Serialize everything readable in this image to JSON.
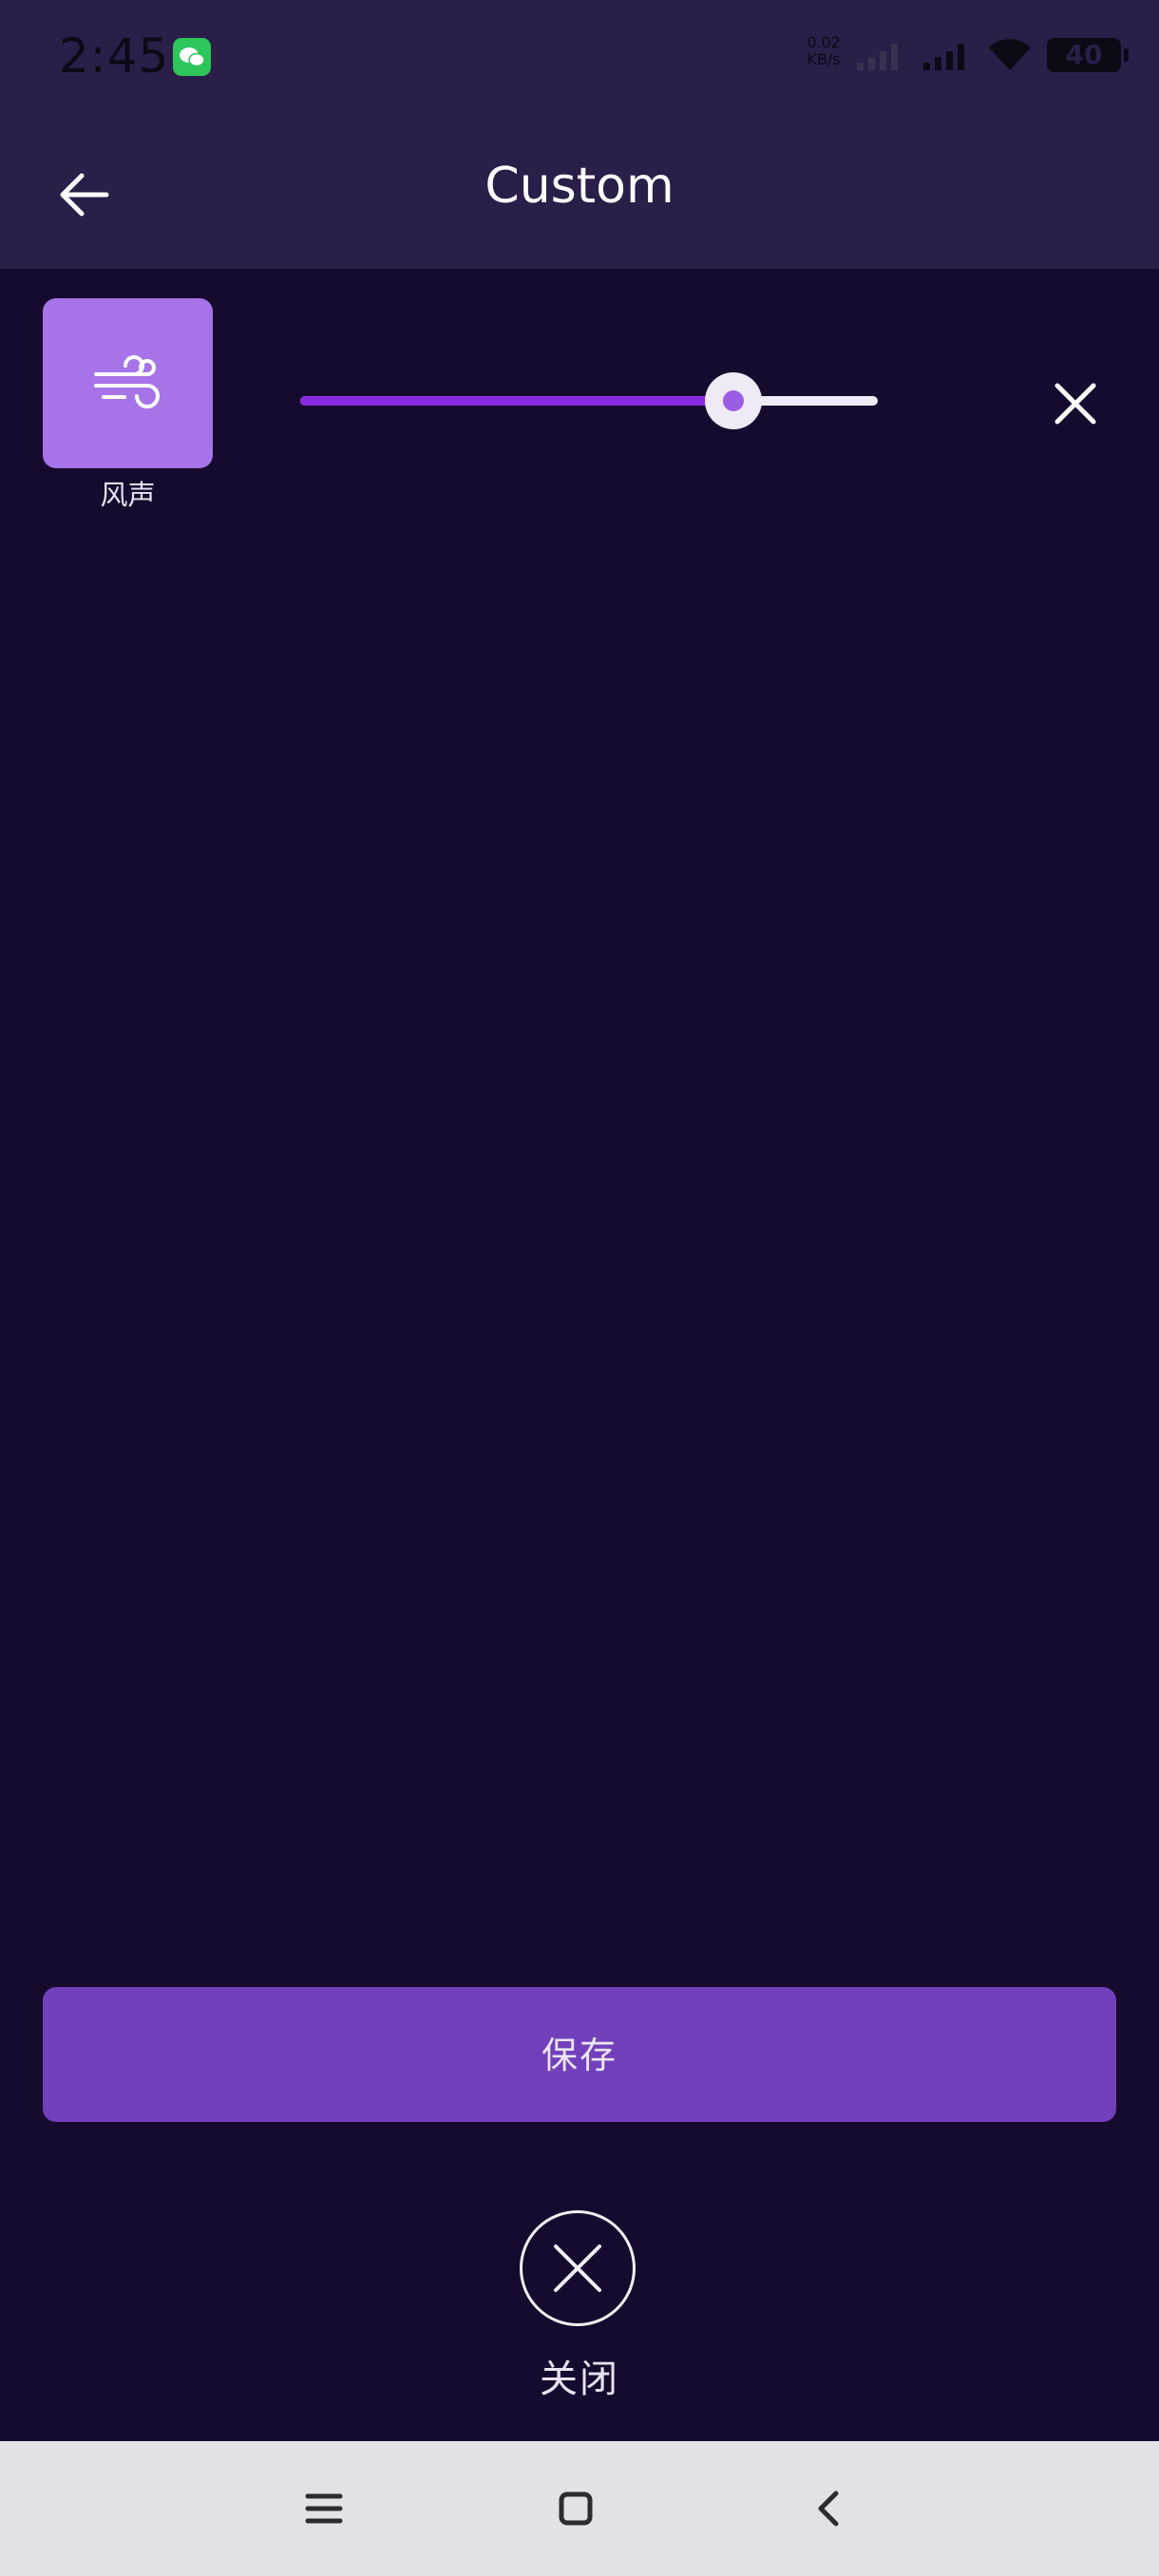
{
  "status_bar": {
    "time": "2:45",
    "net_speed": "0.02\nKB/s",
    "battery": "40"
  },
  "header": {
    "title": "Custom"
  },
  "sound": {
    "label": "风声",
    "icon": "wind-icon",
    "volume": 0.75
  },
  "actions": {
    "save_label": "保存",
    "close_label": "关闭"
  },
  "colors": {
    "background": "#160b2e",
    "header": "#2a1f49",
    "accent": "#8a2be2",
    "tile": "#a673e8",
    "save_button": "#7140ba"
  }
}
